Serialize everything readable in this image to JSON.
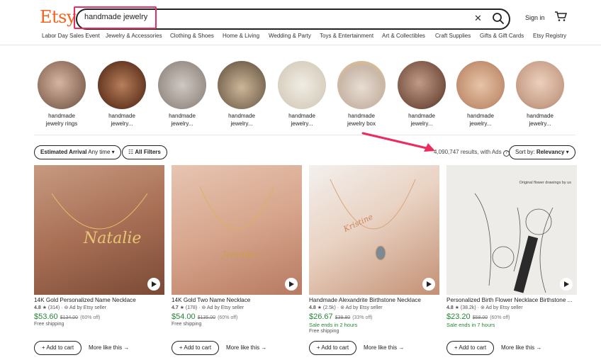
{
  "header": {
    "logo": "Etsy",
    "search_value": "handmade jewelry",
    "signin": "Sign in"
  },
  "nav": [
    "Labor Day Sales Event",
    "Jewelry & Accessories",
    "Clothing & Shoes",
    "Home & Living",
    "Wedding & Party",
    "Toys & Entertainment",
    "Art & Collectibles",
    "Craft Supplies",
    "Gifts & Gift Cards",
    "Etsy Registry"
  ],
  "categories": [
    {
      "line1": "handmade",
      "line2": "jewelry rings"
    },
    {
      "line1": "handmade",
      "line2": "jewelry..."
    },
    {
      "line1": "handmade",
      "line2": "jewelry..."
    },
    {
      "line1": "handmade",
      "line2": "jewelry..."
    },
    {
      "line1": "handmade",
      "line2": "jewelry..."
    },
    {
      "line1": "handmade",
      "line2": "jewelry box"
    },
    {
      "line1": "handmade",
      "line2": "jewelry..."
    },
    {
      "line1": "handmade",
      "line2": "jewelry..."
    },
    {
      "line1": "handmade",
      "line2": "jewelry..."
    }
  ],
  "filters": {
    "arrival_label": "Estimated Arrival",
    "arrival_value": "Any time",
    "all_filters": "All Filters",
    "results": "4,090,747 results, with Ads",
    "sort_label": "Sort by:",
    "sort_value": "Relevancy"
  },
  "products": [
    {
      "title": "14K Gold Personalized Name Necklace",
      "rating": "4.8",
      "reviews": "(314)",
      "ad": "Ad by Etsy seller",
      "price": "$53.60",
      "old": "$134.00",
      "off": "(60% off)",
      "note": "Free shipping",
      "note2": "",
      "add": "Add to cart",
      "more": "More like this"
    },
    {
      "title": "14K Gold Two Name Necklace",
      "rating": "4.7",
      "reviews": "(178)",
      "ad": "Ad by Etsy seller",
      "price": "$54.00",
      "old": "$135.00",
      "off": "(60% off)",
      "note": "Free shipping",
      "note2": "",
      "add": "Add to cart",
      "more": "More like this"
    },
    {
      "title": "Handmade Alexandrite Birthstone Necklace",
      "rating": "4.8",
      "reviews": "(2.5k)",
      "ad": "Ad by Etsy seller",
      "price": "$26.67",
      "old": "$39.80",
      "off": "(33% off)",
      "note": "Sale ends in 2 hours",
      "note2": "Free shipping",
      "add": "Add to cart",
      "more": "More like this"
    },
    {
      "title": "Personalized Birth Flower Necklace Birthstone ...",
      "rating": "4.8",
      "reviews": "(38.2k)",
      "ad": "Ad by Etsy seller",
      "price": "$23.20",
      "old": "$58.00",
      "off": "(60% off)",
      "note": "Sale ends in 7 hours",
      "note2": "",
      "add": "Add to cart",
      "more": "More like this"
    }
  ],
  "image_text": {
    "flower_caption": "Original flower drawings by us"
  },
  "colors": {
    "brand": "#f1641e",
    "sale": "#258635",
    "highlight": "#ec2b5e"
  }
}
